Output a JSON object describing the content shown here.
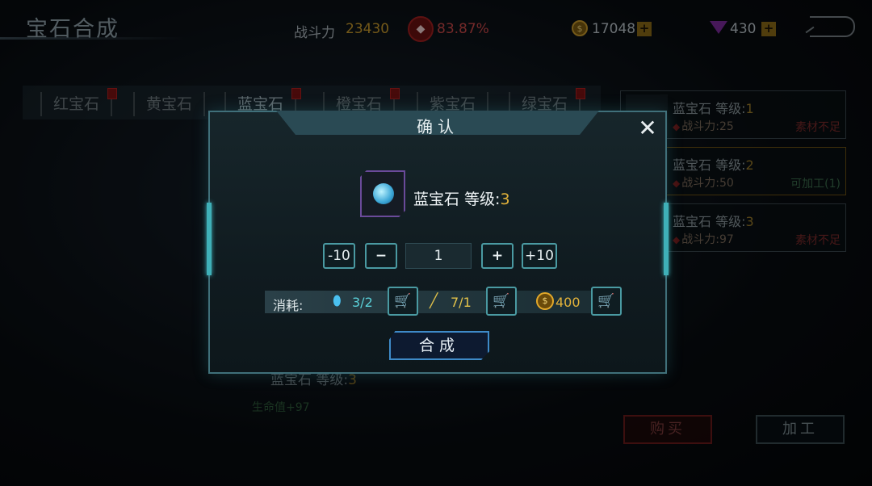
{
  "header": {
    "title": "宝石合成",
    "power_label": "战斗力",
    "power_value": "23430",
    "percent_value": "83.87%",
    "coins": "17048",
    "gems": "430",
    "plus": "+"
  },
  "tabs": [
    {
      "label": "红宝石"
    },
    {
      "label": "黄宝石"
    },
    {
      "label": "蓝宝石"
    },
    {
      "label": "橙宝石"
    },
    {
      "label": "紫宝石"
    },
    {
      "label": "绿宝石"
    }
  ],
  "gem_list": [
    {
      "name": "蓝宝石 等级:",
      "level": "1",
      "power": "战斗力:25",
      "status": "素材不足"
    },
    {
      "name": "蓝宝石 等级:",
      "level": "2",
      "power": "战斗力:50",
      "status": "可加工(1)"
    },
    {
      "name": "蓝宝石 等级:",
      "level": "3",
      "power": "战斗力:97",
      "status": "素材不足"
    }
  ],
  "left_panel": {
    "gem_name": "蓝宝石 等级:",
    "gem_level": "3",
    "hp_bonus": "生命值+97"
  },
  "buttons": {
    "buy": "购买",
    "make": "加工"
  },
  "dialog": {
    "title": "确认",
    "close": "✕",
    "item_name": "蓝宝石 等级:",
    "item_level": "3",
    "minus10": "-10",
    "minus": "−",
    "quantity": "1",
    "plus": "+",
    "plus10": "+10",
    "cost_label": "消耗:",
    "cost_gem": "3/2",
    "cost_tool": "7/1",
    "cost_coin": "400",
    "confirm": "合成"
  },
  "colors": {
    "accent": "#4a9aa2",
    "gold": "#e2b23a",
    "craft_border": "#3e8ac8"
  },
  "icons": [
    "coin-icon",
    "gem-icon",
    "back-icon",
    "close-icon",
    "cart-icon",
    "blue-gem-icon",
    "tool-icon"
  ]
}
